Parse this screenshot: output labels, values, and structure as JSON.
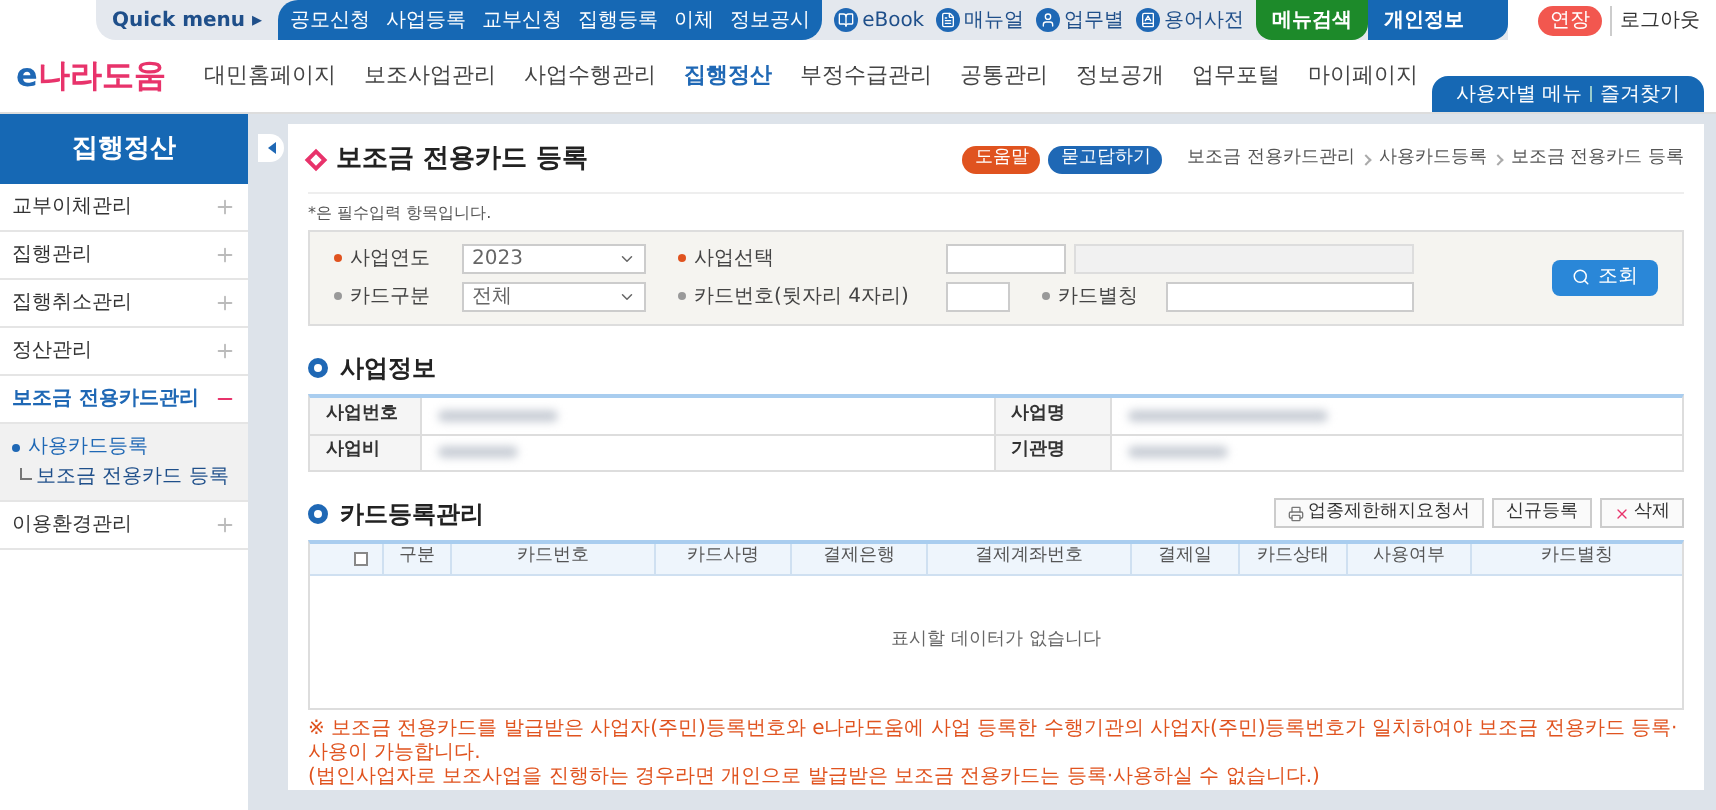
{
  "top_bar": {
    "quick_menu": "Quick menu ▸",
    "quick_links": [
      "공모신청",
      "사업등록",
      "교부신청",
      "집행등록",
      "이체",
      "정보공시"
    ],
    "tools": [
      {
        "label": "eBook",
        "kind": "book"
      },
      {
        "label": "매뉴얼",
        "kind": "manual"
      },
      {
        "label": "업무별",
        "kind": "person"
      },
      {
        "label": "용어사전",
        "kind": "dictionary"
      }
    ],
    "menu_search": "메뉴검색",
    "personal_info": "개인정보",
    "extend": "연장",
    "logout": "로그아웃"
  },
  "logo": {
    "prefix": "e",
    "name": "나라도움"
  },
  "nav": [
    {
      "label": "대민홈페이지",
      "selected": false
    },
    {
      "label": "보조사업관리",
      "selected": false
    },
    {
      "label": "사업수행관리",
      "selected": false
    },
    {
      "label": "집행정산",
      "selected": true
    },
    {
      "label": "부정수급관리",
      "selected": false
    },
    {
      "label": "공통관리",
      "selected": false
    },
    {
      "label": "정보공개",
      "selected": false
    },
    {
      "label": "업무포털",
      "selected": false
    },
    {
      "label": "마이페이지",
      "selected": false
    }
  ],
  "user_menu_tab": [
    "사용자별 메뉴",
    "즐겨찾기"
  ],
  "sidebar": {
    "title": "집행정산",
    "items": [
      {
        "label": "교부이체관리",
        "expanded": false
      },
      {
        "label": "집행관리",
        "expanded": false
      },
      {
        "label": "집행취소관리",
        "expanded": false
      },
      {
        "label": "정산관리",
        "expanded": false
      },
      {
        "label": "보조금 전용카드관리",
        "expanded": true,
        "children": [
          {
            "label": "사용카드등록",
            "children": [
              {
                "label": "보조금 전용카드 등록"
              }
            ]
          }
        ]
      },
      {
        "label": "이용환경관리",
        "expanded": false
      }
    ]
  },
  "page": {
    "title": "보조금 전용카드 등록",
    "help_buttons": [
      {
        "label": "도움말",
        "color": "#e0531f"
      },
      {
        "label": "묻고답하기",
        "color": "#1f68b5"
      }
    ],
    "breadcrumb": [
      "보조금 전용카드관리",
      "사용카드등록",
      "보조금 전용카드 등록"
    ],
    "required_note": "*은 필수입력 항목입니다.",
    "search": {
      "fields": [
        {
          "label": "사업연도",
          "required": true,
          "kind": "select",
          "value": "2023"
        },
        {
          "label": "사업선택",
          "required": true,
          "kind": "project"
        },
        {
          "label": "카드구분",
          "required": false,
          "kind": "select",
          "value": "전체"
        },
        {
          "label": "카드번호(뒷자리 4자리)",
          "required": false,
          "kind": "short"
        },
        {
          "label": "카드별칭",
          "required": false,
          "kind": "text"
        }
      ],
      "button": "조회"
    },
    "project_info": {
      "title": "사업정보",
      "rows": [
        [
          "사업번호",
          "사업명"
        ],
        [
          "사업비",
          "기관명"
        ]
      ]
    },
    "cards": {
      "title": "카드등록관리",
      "buttons": [
        {
          "label": "업종제한해지요청서",
          "kind": "print"
        },
        {
          "label": "신규등록",
          "kind": "plain"
        },
        {
          "label": "삭제",
          "kind": "delete"
        }
      ],
      "columns": [
        "구분",
        "카드번호",
        "카드사명",
        "결제은행",
        "결제계좌번호",
        "결제일",
        "카드상태",
        "사용여부",
        "카드별칭"
      ],
      "select_all": false,
      "empty": "표시할 데이터가 없습니다"
    },
    "notes": [
      "※ 보조금 전용카드를 발급받은 사업자(주민)등록번호와 e나라도움에 사업 등록한 수행기관의 사업자(주민)등록번호가 일치하여야 보조금 전용카드 등록·사용이 가능합니다.",
      "(법인사업자로 보조사업을 진행하는 경우라면 개인으로 발급받은 보조금 전용카드는 등록·사용하실 수 없습니다.)"
    ]
  }
}
